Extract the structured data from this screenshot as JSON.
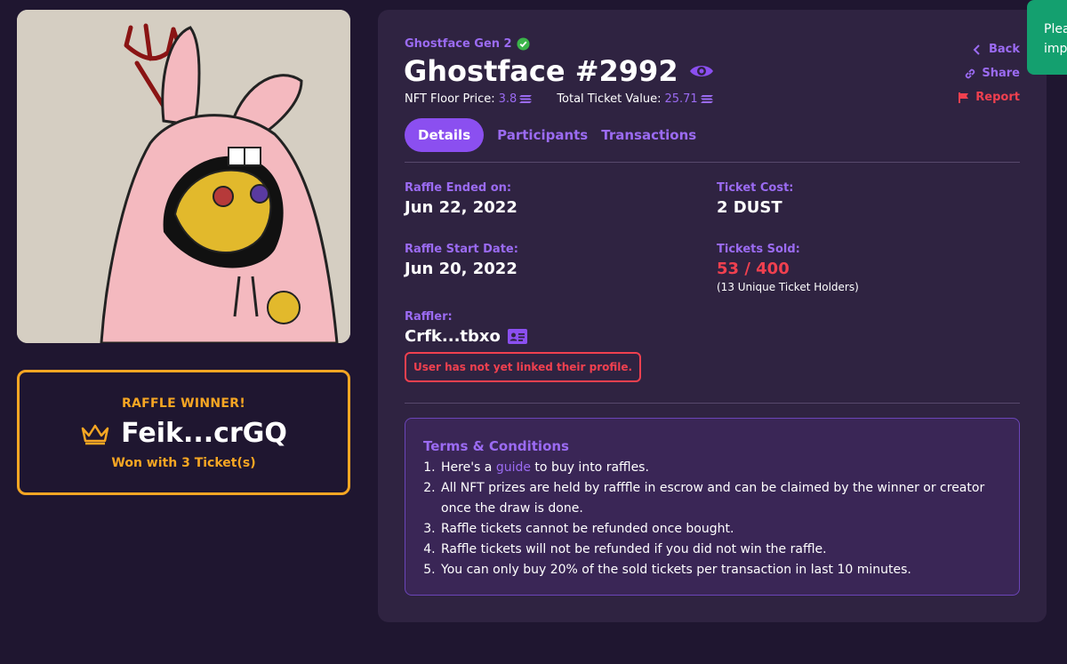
{
  "nft": {
    "collection": "Ghostface Gen 2",
    "title": "Ghostface #2992",
    "floor_label": "NFT Floor Price:",
    "floor_value": "3.8",
    "total_label": "Total Ticket Value:",
    "total_value": "25.71"
  },
  "actions": {
    "back": "Back",
    "share": "Share",
    "report": "Report"
  },
  "tabs": [
    {
      "label": "Details",
      "active": true
    },
    {
      "label": "Participants",
      "active": false
    },
    {
      "label": "Transactions",
      "active": false
    }
  ],
  "details": {
    "ended_label": "Raffle Ended on:",
    "ended_value": "Jun 22, 2022",
    "cost_label": "Ticket Cost:",
    "cost_value": "2 DUST",
    "start_label": "Raffle Start Date:",
    "start_value": "Jun 20, 2022",
    "sold_label": "Tickets Sold:",
    "sold_value": "53 / 400",
    "holders": "(13 Unique Ticket Holders)",
    "raffler_label": "Raffler:",
    "raffler_value": "Crfk...tbxo",
    "unlinked_notice": "User has not yet linked their profile."
  },
  "winner": {
    "heading": "RAFFLE WINNER!",
    "name": "Feik...crGQ",
    "sub": "Won with 3 Ticket(s)"
  },
  "terms": {
    "title": "Terms & Conditions",
    "item1_pre": "Here's a ",
    "item1_link": "guide",
    "item1_post": " to buy into raffles.",
    "items": [
      "All NFT prizes are held by rafffle in escrow and can be claimed by the winner or creator once the draw is done.",
      "Raffle tickets cannot be refunded once bought.",
      "Raffle tickets will not be refunded if you did not win the raffle.",
      "You can only buy 20% of the sold tickets per transaction in last 10 minutes."
    ]
  },
  "toast": {
    "line1": "Plea",
    "line2": "imp"
  },
  "colors": {
    "accent": "#9b6bf2",
    "active_tab": "#8b4ff0",
    "winner": "#f6a623",
    "error": "#f0404f",
    "toast": "#14a06f"
  }
}
